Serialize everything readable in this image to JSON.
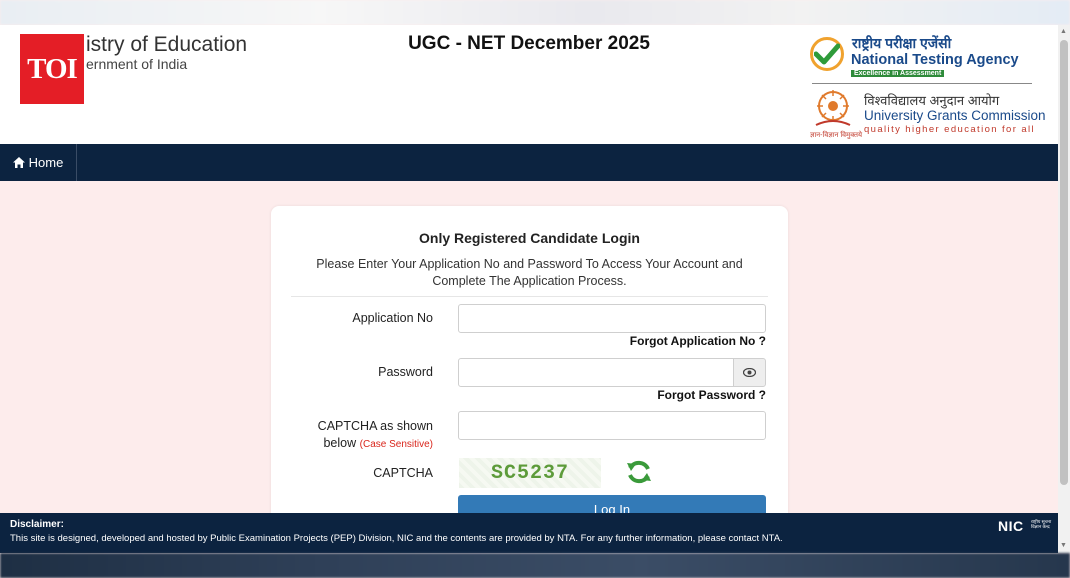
{
  "header": {
    "toi": "TOI",
    "ministry": "istry of Education",
    "ministry_sub": "ernment of India",
    "exam_title": "UGC - NET December 2025",
    "nta_hindi": "राष्ट्रीय परीक्षा एजेंसी",
    "nta_name": "National Testing Agency",
    "nta_tagline": "Excellence in Assessment",
    "ugc_hindi": "विश्वविद्यालय अनुदान आयोग",
    "ugc_name": "University Grants Commission",
    "ugc_tagline": "quality higher education for all",
    "ugc_motto": "ज्ञान-विज्ञान विमुक्तये"
  },
  "nav": {
    "home_label": "Home"
  },
  "login": {
    "title": "Only Registered Candidate Login",
    "subtitle": "Please Enter Your Application No and Password To Access Your Account and Complete The Application Process.",
    "app_no_label": "Application No",
    "app_no_value": "",
    "forgot_app_no": "Forgot Application No ?",
    "password_label": "Password",
    "password_value": "",
    "forgot_password": "Forgot Password ?",
    "captcha_input_label_1": "CAPTCHA as shown",
    "captcha_input_label_2": "below",
    "case_sensitive": "(Case Sensitive)",
    "captcha_input_value": "",
    "captcha_label": "CAPTCHA",
    "captcha_text": "SC5237",
    "login_button": "Log In"
  },
  "footer": {
    "disclaimer_title": "Disclaimer:",
    "disclaimer_text": "This site is designed, developed and hosted by Public Examination Projects (PEP) Division, NIC and the contents are provided by NTA. For any further information, please contact NTA.",
    "nic": "NIC",
    "nic_sub": "राष्ट्रीय सूचना विज्ञान केन्द्र"
  },
  "colors": {
    "nav_bg": "#0c2340",
    "page_bg": "#fdecec",
    "button_blue": "#337ab7",
    "toi_red": "#e41e26",
    "captcha_green": "#5d9b3a",
    "case_red": "#d9261c"
  },
  "icons": [
    "home-icon",
    "eye-icon",
    "refresh-icon",
    "nta-tick-icon",
    "ugc-emblem-icon"
  ]
}
